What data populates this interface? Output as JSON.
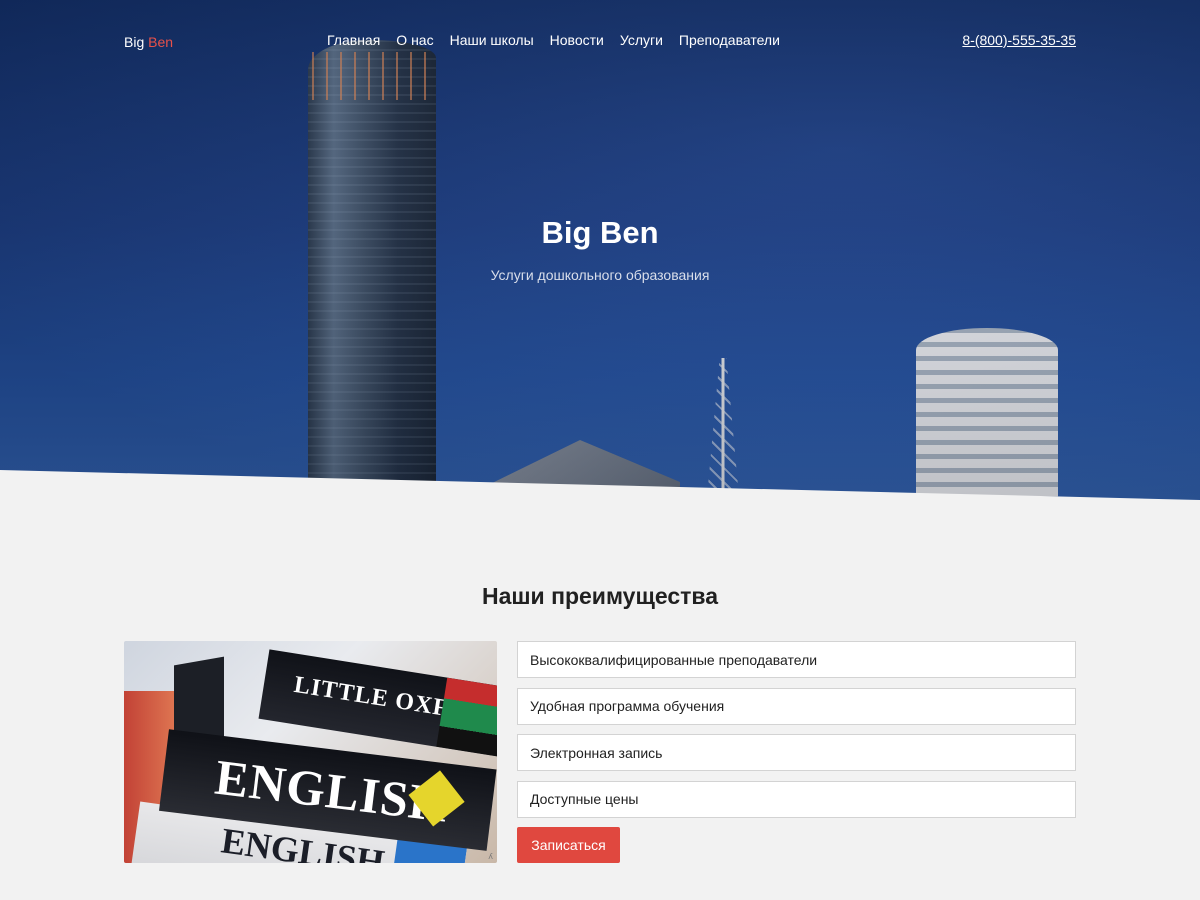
{
  "header": {
    "logo": {
      "part1": "Big",
      "part2": "Ben"
    },
    "menu": [
      {
        "label": "Главная"
      },
      {
        "label": "О нас"
      },
      {
        "label": "Наши школы"
      },
      {
        "label": "Новости"
      },
      {
        "label": "Услуги"
      },
      {
        "label": "Преподаватели"
      }
    ],
    "phone": "8-(800)-555-35-35"
  },
  "hero": {
    "title": "Big Ben",
    "subtitle": "Услуги дошкольного образования",
    "image": "city-skyscrapers-photo"
  },
  "advantages": {
    "title": "Наши преимущества",
    "image": "english-dictionaries-photo",
    "image_text": {
      "book1": "LITTLE OXFORD",
      "book2": "ENGLISH",
      "book3": "ENGLISH"
    },
    "items": [
      {
        "label": "Высококвалифицированные преподаватели"
      },
      {
        "label": "Удобная программа обучения"
      },
      {
        "label": "Электронная запись"
      },
      {
        "label": "Доступные цены"
      }
    ],
    "button_label": "Записаться"
  },
  "colors": {
    "accent": "#e0483f",
    "hero_blue": "#1d3f86",
    "page_bg": "#f2f2f2"
  }
}
